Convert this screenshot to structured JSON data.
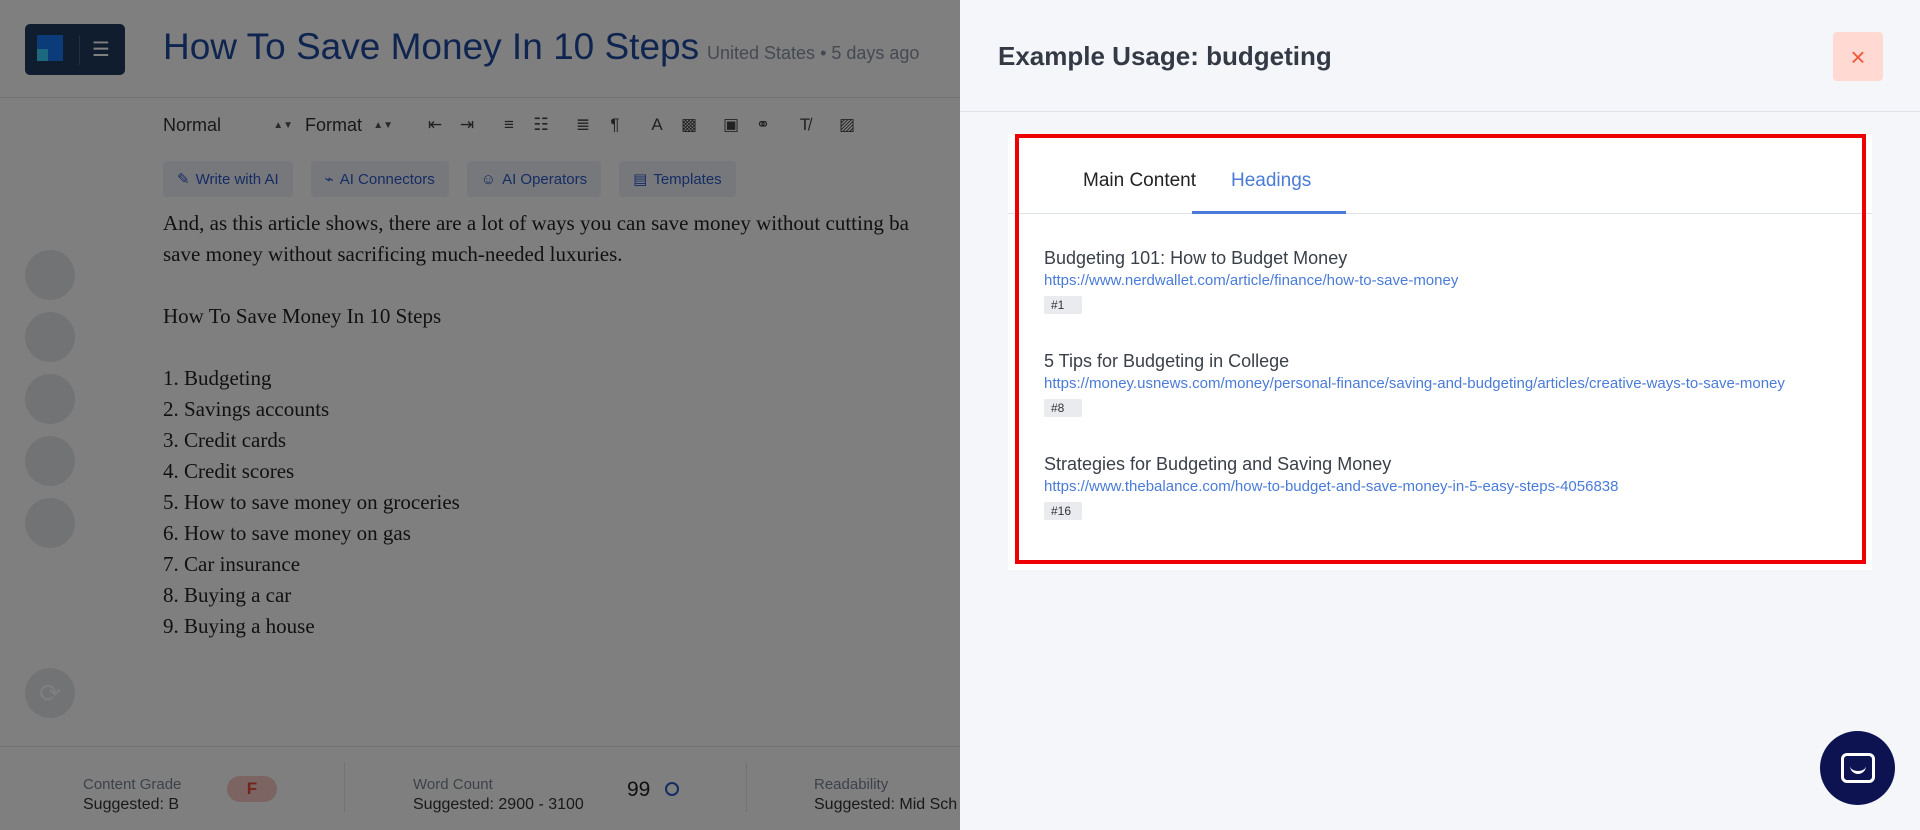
{
  "editor": {
    "title": "How To Save Money In 10 Steps",
    "meta": "United States • 5 days ago",
    "toolbar": {
      "style_select": "Normal",
      "format_select": "Format"
    },
    "ai_buttons": [
      {
        "label": "Write with AI",
        "icon": "pen-icon"
      },
      {
        "label": "AI Connectors",
        "icon": "plug-icon"
      },
      {
        "label": "AI Operators",
        "icon": "robot-icon"
      },
      {
        "label": "Templates",
        "icon": "template-icon"
      }
    ],
    "body": {
      "para1_line1": "And, as this article shows, there are a lot of ways you can save money without cutting ba",
      "para1_line2": "save money without sacrificing much-needed luxuries.",
      "heading": "How To Save Money In 10 Steps",
      "list": [
        " 1. Budgeting",
        "2. Savings accounts",
        "3. Credit cards",
        "4. Credit scores",
        "5. How to save money on groceries",
        "6. How to save money on gas",
        "7. Car insurance",
        "8. Buying a car",
        "9. Buying a house"
      ]
    },
    "metrics": {
      "grade_label": "Content Grade",
      "grade_suggested": "Suggested: B",
      "grade_value": "F",
      "wc_label": "Word Count",
      "wc_suggested": "Suggested: 2900 - 3100",
      "wc_value": "99",
      "read_label": "Readability",
      "read_suggested": "Suggested: Mid Sch"
    }
  },
  "drawer": {
    "title": "Example Usage: budgeting",
    "close_label": "×",
    "tabs": [
      {
        "label": "Main Content",
        "active": false
      },
      {
        "label": "Headings",
        "active": true
      }
    ],
    "results": [
      {
        "title": "Budgeting 101: How to Budget Money",
        "url": "https://www.nerdwallet.com/article/finance/how-to-save-money",
        "rank": "#1"
      },
      {
        "title": "5 Tips for Budgeting in College",
        "url": "https://money.usnews.com/money/personal-finance/saving-and-budgeting/articles/creative-ways-to-save-money",
        "rank": "#8"
      },
      {
        "title": "Strategies for Budgeting and Saving Money",
        "url": "https://www.thebalance.com/how-to-budget-and-save-money-in-5-easy-steps-4056838",
        "rank": "#16"
      }
    ]
  },
  "colors": {
    "accent_blue": "#4a7bd8",
    "title_blue": "#1e4a9e",
    "highlight_red": "#ee0000",
    "close_bg": "#ffd9d2",
    "chat_navy": "#0d1350"
  }
}
